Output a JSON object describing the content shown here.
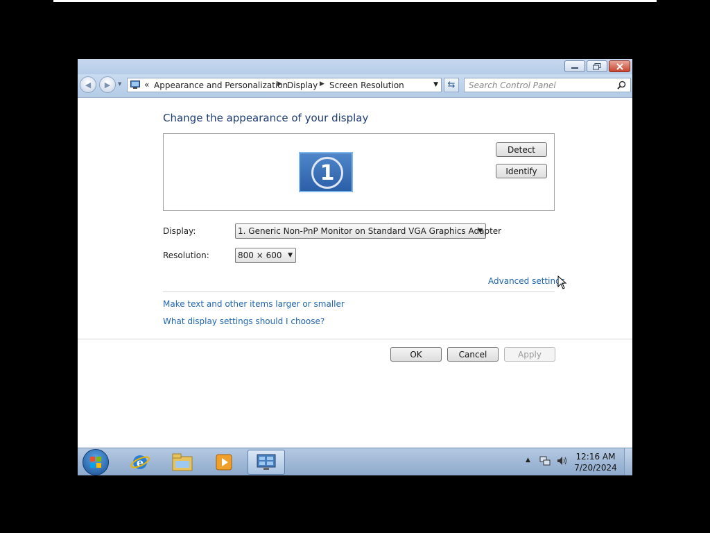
{
  "address_bar": {
    "breadcrumbs": [
      "Appearance and Personalization",
      "Display",
      "Screen Resolution"
    ],
    "overflow_chevron": "«"
  },
  "search": {
    "placeholder": "Search Control Panel"
  },
  "page": {
    "heading": "Change the appearance of your display",
    "monitor_number": "1",
    "detect_label": "Detect",
    "identify_label": "Identify",
    "display_label": "Display:",
    "display_value": "1. Generic Non-PnP Monitor on Standard VGA Graphics Adapter",
    "resolution_label": "Resolution:",
    "resolution_value": "800 × 600",
    "advanced_link": "Advanced settings",
    "links": [
      "Make text and other items larger or smaller",
      "What display settings should I choose?"
    ],
    "ok_label": "OK",
    "cancel_label": "Cancel",
    "apply_label": "Apply"
  },
  "taskbar": {
    "pinned": [
      "start-button",
      "internet-explorer-icon",
      "windows-explorer-icon",
      "media-player-icon",
      "control-panel-icon"
    ],
    "clock_time": "12:16 AM",
    "clock_date": "7/20/2024"
  },
  "colors": {
    "heading": "#1e3d73",
    "link": "#1e65b0",
    "taskbar": "#a7bfdc",
    "close_button": "#c7452d"
  }
}
